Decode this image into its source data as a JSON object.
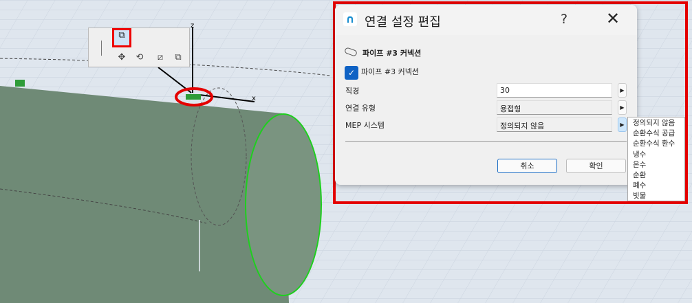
{
  "viewport": {
    "axis_z": "z",
    "axis_x": "x"
  },
  "toolbar": {
    "tools": [
      "connection-settings",
      "move",
      "rotate",
      "split",
      "merge"
    ]
  },
  "dialog": {
    "title": "연결 설정 편집",
    "help_label": "?",
    "close_label": "✕",
    "header": "파이프 #3 커넥션",
    "checkbox_label": "파이프 #3 커넥션",
    "checkbox_checked": true,
    "fields": [
      {
        "label": "직경",
        "value": "30"
      },
      {
        "label": "연결 유형",
        "value": "용접형"
      },
      {
        "label": "MEP 시스템",
        "value": "정의되지 않음"
      }
    ],
    "cancel_label": "취소",
    "ok_label": "확인"
  },
  "dropdown": {
    "options": [
      "정의되지 않음",
      "순환수식 공급",
      "순환수식 환수",
      "냉수",
      "온수",
      "순환",
      "폐수",
      "빗물"
    ]
  },
  "colors": {
    "highlight": "#e40000",
    "accent": "#0f62c4",
    "pipe": "#6f8a76"
  }
}
